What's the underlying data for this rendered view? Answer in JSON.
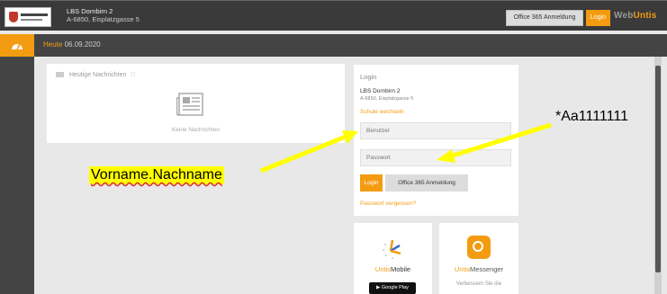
{
  "header": {
    "school_name": "LBS Dornbirn 2",
    "school_address": "A-6850, Eisplatzgasse 5",
    "o365_button": "Office 365 Anmeldung",
    "login_button": "Login",
    "brand_web": "Web",
    "brand_untis": "Untis"
  },
  "datebar": {
    "label": "Heute",
    "date": "06.09.2020"
  },
  "news": {
    "title": "Heutige Nachrichten",
    "empty": "Keine Nachrichten"
  },
  "login": {
    "title": "Login",
    "school": "LBS Dornbirn 2",
    "address": "A-6850, Eisplatzgasse 5",
    "switch_school": "Schule wechseln",
    "username_placeholder": "Benutzer",
    "password_placeholder": "Passwort",
    "login_button": "Login",
    "o365_button": "Office 365 Anmeldung",
    "forgot": "Passwort vergessen?"
  },
  "apps": {
    "mobile_prefix": "Untis",
    "mobile_suffix": "Mobile",
    "google_play": "Google Play",
    "messenger_prefix": "Untis",
    "messenger_suffix": "Messenger",
    "messenger_desc": "Verbessern Sie die"
  },
  "annotations": {
    "username_hint": "Vorname.Nachname",
    "password_hint": "*Aa1111111",
    "highlight_color": "#ffff00"
  },
  "colors": {
    "accent": "#f39c12",
    "topbar": "#3a3a3a",
    "arrow": "#ffff00"
  }
}
